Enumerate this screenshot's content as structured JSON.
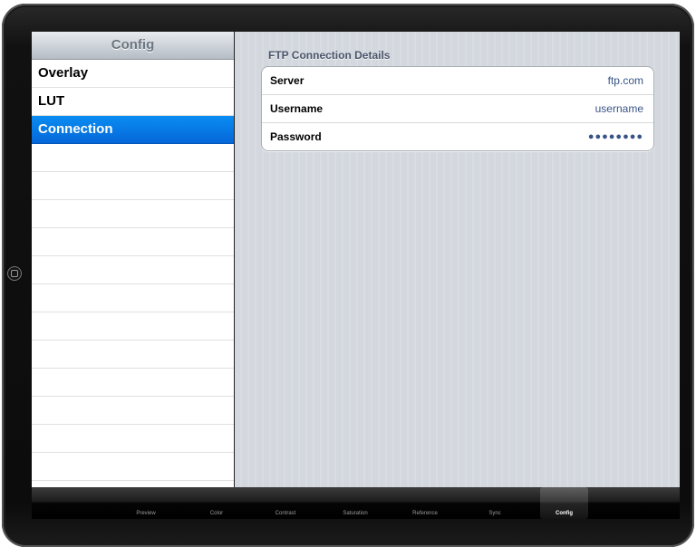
{
  "master": {
    "title": "Config",
    "items": [
      {
        "label": "Overlay",
        "selected": false
      },
      {
        "label": "LUT",
        "selected": false
      },
      {
        "label": "Connection",
        "selected": true
      }
    ],
    "empty_rows": 12
  },
  "detail": {
    "section_title": "FTP Connection Details",
    "rows": [
      {
        "label": "Server",
        "value": "ftp.com"
      },
      {
        "label": "Username",
        "value": "username"
      },
      {
        "label": "Password",
        "value": "●●●●●●●●"
      }
    ]
  },
  "tabbar": {
    "tabs": [
      "Preview",
      "Color",
      "Contrast",
      "Saturation",
      "Reference",
      "Sync",
      "Config"
    ],
    "active": "Config"
  },
  "colors": {
    "selection": "#0a7ae6",
    "value_text": "#385487",
    "detail_bg": "#d6dbe0"
  },
  "icons": {
    "home_button": "home-button-icon"
  }
}
